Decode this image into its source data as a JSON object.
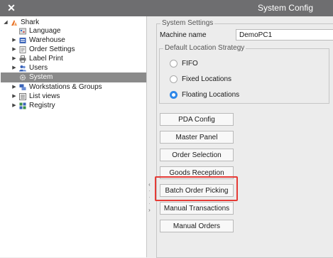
{
  "window": {
    "title": "System Config",
    "close_glyph": "✕"
  },
  "tree": {
    "root": {
      "label": "Shark",
      "icon": "shark-logo-icon",
      "expanded": true
    },
    "items": [
      {
        "label": "Language",
        "icon": "language-icon",
        "expandable": false
      },
      {
        "label": "Warehouse",
        "icon": "warehouse-icon",
        "expandable": true
      },
      {
        "label": "Order Settings",
        "icon": "order-settings-icon",
        "expandable": true
      },
      {
        "label": "Label Print",
        "icon": "printer-icon",
        "expandable": true
      },
      {
        "label": "Users",
        "icon": "users-icon",
        "expandable": true
      },
      {
        "label": "System",
        "icon": "system-gear-icon",
        "expandable": false,
        "selected": true
      },
      {
        "label": "Workstations & Groups",
        "icon": "workstations-icon",
        "expandable": true
      },
      {
        "label": "List views",
        "icon": "list-views-icon",
        "expandable": true
      },
      {
        "label": "Registry",
        "icon": "registry-icon",
        "expandable": true
      }
    ]
  },
  "settings": {
    "group_label": "System Settings",
    "machine_name_label": "Machine name",
    "machine_name_value": "DemoPC1",
    "strategy": {
      "group_label": "Default Location Strategy",
      "options": [
        {
          "label": "FIFO",
          "selected": false
        },
        {
          "label": "Fixed Locations",
          "selected": false
        },
        {
          "label": "Floating Locations",
          "selected": true
        }
      ]
    },
    "buttons": [
      "PDA Config",
      "Master Panel",
      "Order Selection",
      "Goods Reception",
      "Batch Order Picking",
      "Manual Transactions",
      "Manual Orders"
    ],
    "highlighted_button": "Batch Order Picking"
  },
  "colors": {
    "titlebar": "#6e6e70",
    "selection": "#8a8a8a",
    "radio_accent": "#2e87e8",
    "highlight_box": "#e53b36",
    "shark_orange": "#e8742a"
  }
}
